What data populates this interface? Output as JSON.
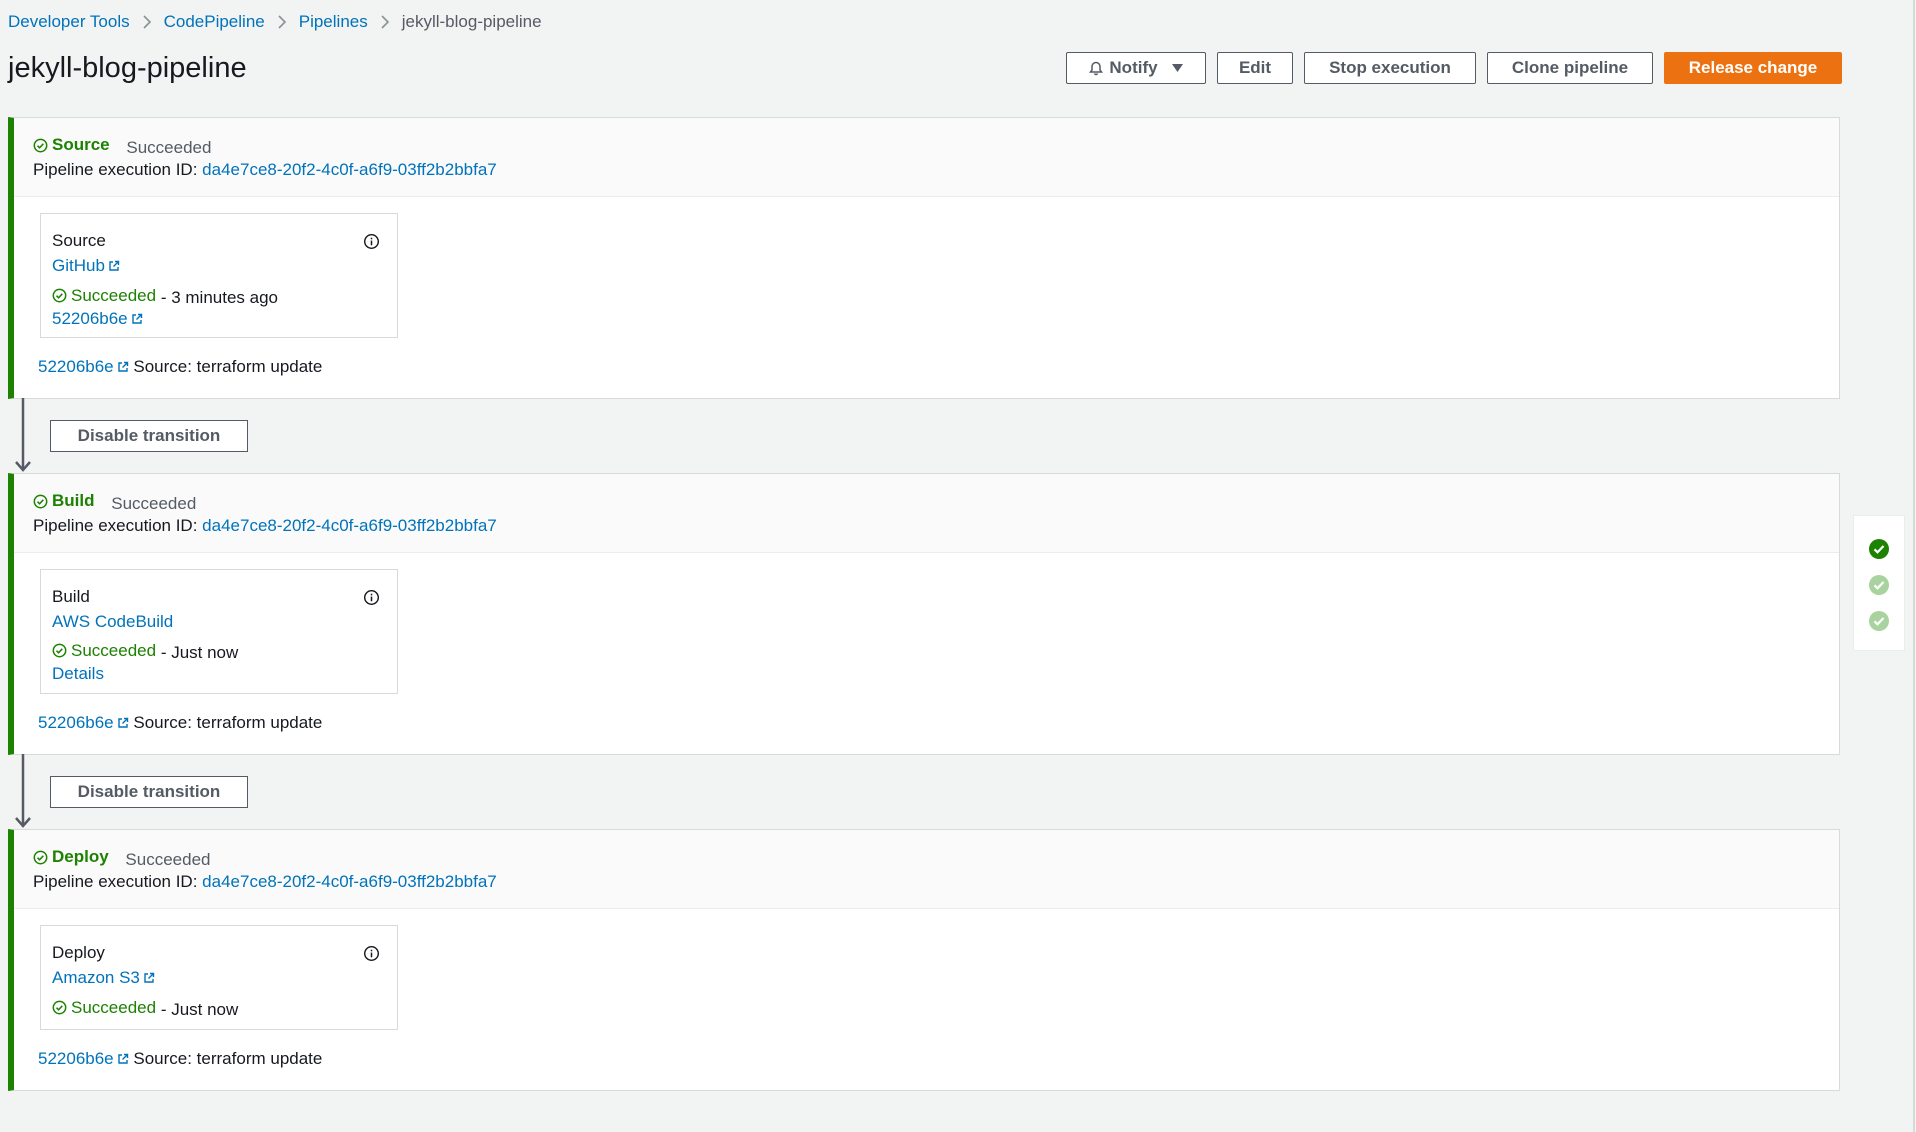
{
  "breadcrumb": {
    "items": [
      "Developer Tools",
      "CodePipeline",
      "Pipelines"
    ],
    "current": "jekyll-blog-pipeline"
  },
  "title": "jekyll-blog-pipeline",
  "actions": {
    "notify": "Notify",
    "edit": "Edit",
    "stop": "Stop execution",
    "clone": "Clone pipeline",
    "release": "Release change"
  },
  "execution_label": "Pipeline execution ID:",
  "execution_id": "da4e7ce8-20f2-4c0f-a6f9-03ff2b2bbfa7",
  "transition_label": "Disable transition",
  "stages": [
    {
      "name": "Source",
      "status": "Succeeded",
      "action": {
        "name": "Source",
        "provider": "GitHub",
        "state": "Succeeded",
        "time": "- 3 minutes ago",
        "extra": "52206b6e"
      },
      "commit": "52206b6e",
      "commit_msg": "Source: terraform update"
    },
    {
      "name": "Build",
      "status": "Succeeded",
      "action": {
        "name": "Build",
        "provider": "AWS CodeBuild",
        "state": "Succeeded",
        "time": "- Just now",
        "extra": "Details"
      },
      "commit": "52206b6e",
      "commit_msg": "Source: terraform update"
    },
    {
      "name": "Deploy",
      "status": "Succeeded",
      "action": {
        "name": "Deploy",
        "provider": "Amazon S3",
        "state": "Succeeded",
        "time": "- Just now"
      },
      "commit": "52206b6e",
      "commit_msg": "Source: terraform update"
    }
  ],
  "colors": {
    "success": "#1d8102",
    "link": "#0073bb",
    "primary": "#ec7211"
  }
}
